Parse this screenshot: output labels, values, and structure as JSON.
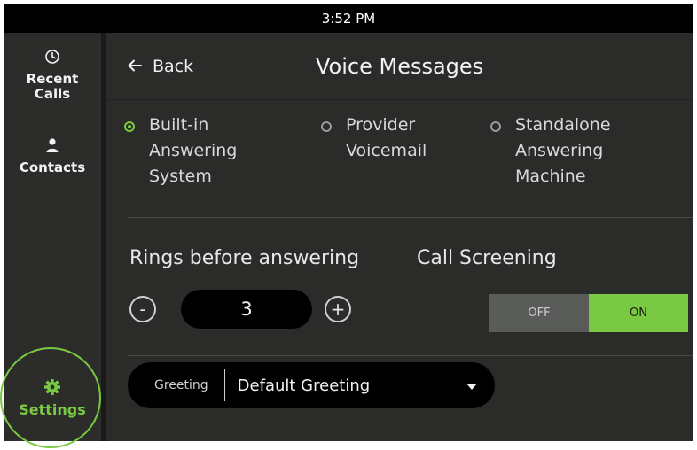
{
  "status_bar": {
    "time": "3:52 PM"
  },
  "sidebar": {
    "items": [
      {
        "label": "Recent\nCalls",
        "icon": "clock-icon"
      },
      {
        "label": "Contacts",
        "icon": "person-icon"
      },
      {
        "label": "Settings",
        "icon": "gear-icon",
        "active": true
      }
    ]
  },
  "header": {
    "back_label": "Back",
    "title": "Voice Messages"
  },
  "answering_options": [
    {
      "label": "Built-in\nAnswering\nSystem",
      "selected": true
    },
    {
      "label": "Provider\nVoicemail",
      "selected": false
    },
    {
      "label": "Standalone\nAnswering\nMachine",
      "selected": false
    }
  ],
  "rings": {
    "label": "Rings before answering",
    "value": "3",
    "minus": "-",
    "plus": "+"
  },
  "call_screening": {
    "label": "Call Screening",
    "off_label": "OFF",
    "on_label": "ON",
    "state": "ON"
  },
  "greeting": {
    "label": "Greeting",
    "value": "Default Greeting"
  },
  "colors": {
    "accent": "#7ac943",
    "background": "#2b2c2a",
    "statusbar": "#000000"
  }
}
